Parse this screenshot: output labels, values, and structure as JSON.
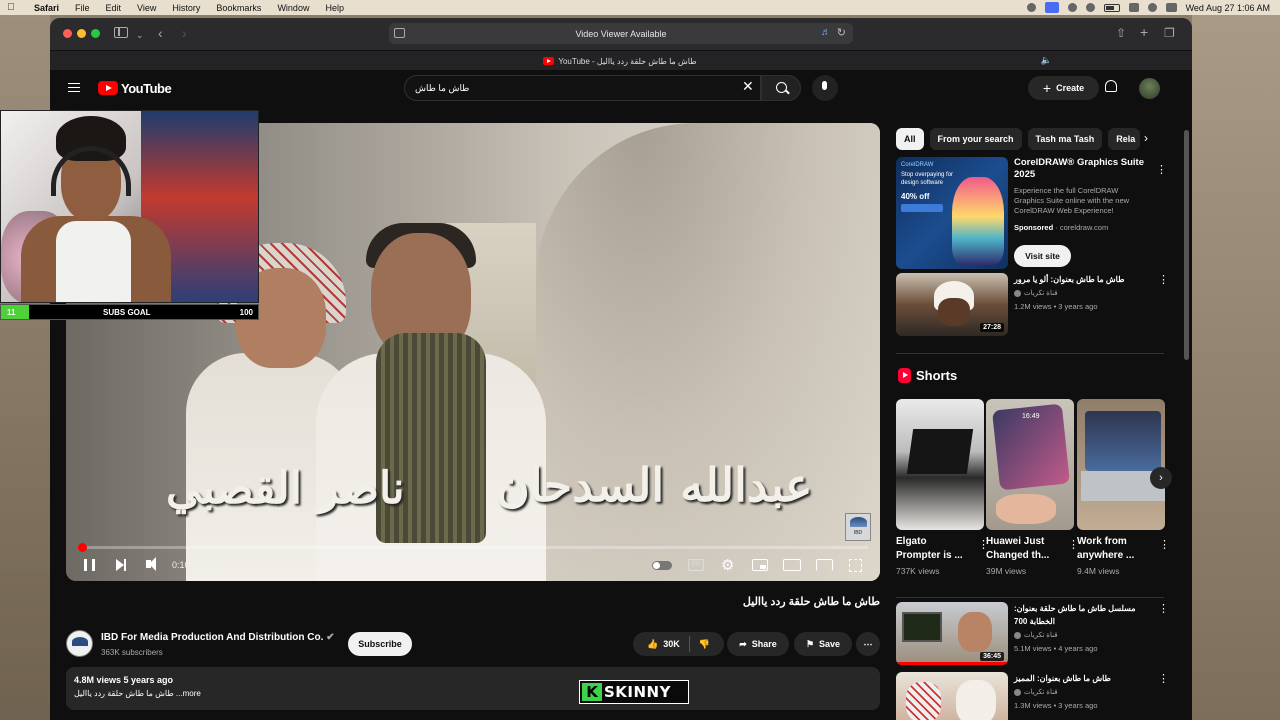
{
  "menubar": {
    "app_name": "Safari",
    "items": [
      "File",
      "Edit",
      "View",
      "History",
      "Bookmarks",
      "Window",
      "Help"
    ],
    "clock": "Wed Aug 27  1:06 AM"
  },
  "browser": {
    "address_text": "Video Viewer Available",
    "tab_title": "YouTube - طاش ما طاش حلقة ردد يااليل"
  },
  "youtube": {
    "logo_text": "YouTube",
    "search_value": "طاش ما طاش",
    "create_label": "Create",
    "player": {
      "overlay_name_left": "ناصر القصبي",
      "overlay_name_right": "عبدالله السدحان",
      "channel_bug": "IBD",
      "time_text": "0:10 / 36:27",
      "progress_fraction": 0.0046
    },
    "video": {
      "title": "طاش ما طاش حلقة ردد يااليل",
      "channel_name": "IBD For Media Production And Distribution Co.",
      "channel_subs": "363K subscribers",
      "subscribe_label": "Subscribe",
      "like_count": "30K",
      "share_label": "Share",
      "save_label": "Save",
      "desc_meta": "4.8M views  5 years ago",
      "desc_text": "طاش ما طاش حلقة ردد يااليل ...more"
    },
    "chips": [
      "All",
      "From your search",
      "Tash ma Tash",
      "Rela"
    ],
    "ad": {
      "thumb_brand": "CorelDRAW",
      "thumb_line": "Stop overpaying for design software",
      "thumb_pct": "40% off",
      "title": "CorelDRAW® Graphics Suite 2025",
      "description": "Experience the full CorelDRAW Graphics Suite online with the new CorelDRAW Web Experience!",
      "sponsored": "Sponsored",
      "domain": "coreldraw.com",
      "cta": "Visit site"
    },
    "recs": [
      {
        "title": "طاش ما طاش بعنوان: ألو يا مرور",
        "channel": "قناة تكريات",
        "meta": "1.2M views • 3 years ago",
        "duration": "27:28"
      },
      {
        "title": "مسلسل طاش ما طاش حلقة بعنوان: الخطابة 700",
        "channel": "قناة تكريات",
        "meta": "5.1M views • 4 years ago",
        "duration": "36:45"
      },
      {
        "title": "طاش ما طاش بعنوان: المميز",
        "channel": "قناة تكريات",
        "meta": "1.3M views • 3 years ago",
        "duration": ""
      }
    ],
    "shorts_heading": "Shorts",
    "shorts": [
      {
        "title": "Elgato Prompter is ...",
        "views": "737K views",
        "thumb_text": ""
      },
      {
        "title": "Huawei Just Changed th...",
        "views": "39M views",
        "thumb_text": "16:49"
      },
      {
        "title": "Work from anywhere ...",
        "views": "9.4M views",
        "thumb_text": ""
      }
    ]
  },
  "overlay": {
    "subs_current": "11",
    "subs_label": "SUBS GOAL",
    "subs_max": "100",
    "subs_fraction": 0.11,
    "watermark_k": "K",
    "watermark_word": "SKINNY"
  },
  "colors": {
    "yt_red": "#ff0000",
    "subs_green": "#4cd137",
    "bg_dark": "#0f0f0f"
  }
}
